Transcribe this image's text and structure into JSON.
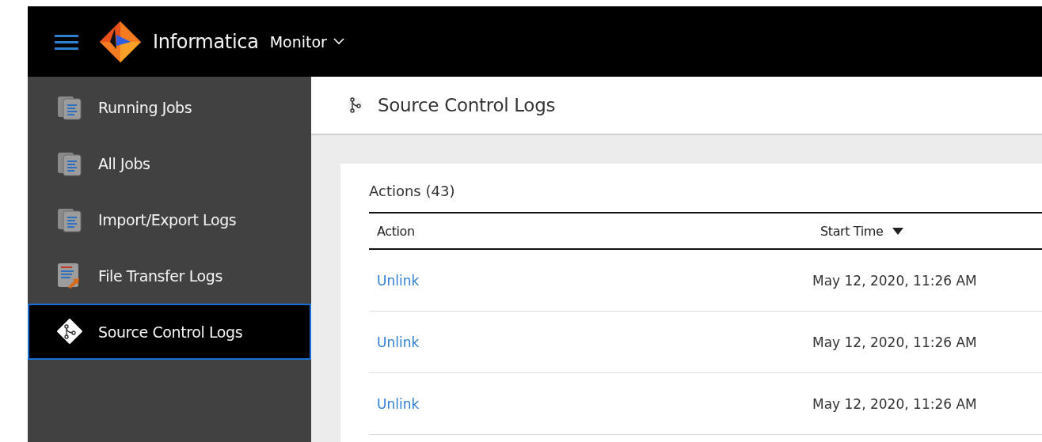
{
  "header": {
    "brand": "Informatica",
    "app_switcher": "Monitor"
  },
  "sidebar": {
    "items": [
      {
        "label": "Running Jobs",
        "kind": "jobs",
        "selected": false
      },
      {
        "label": "All Jobs",
        "kind": "jobs",
        "selected": false
      },
      {
        "label": "Import/Export Logs",
        "kind": "jobs",
        "selected": false
      },
      {
        "label": "File Transfer Logs",
        "kind": "transfer",
        "selected": false
      },
      {
        "label": "Source Control Logs",
        "kind": "source",
        "selected": true
      }
    ]
  },
  "page": {
    "title": "Source Control Logs"
  },
  "table": {
    "title": "Actions (43)",
    "columns": [
      {
        "label": "Action",
        "sorted": false
      },
      {
        "label": "Start Time",
        "sorted": true
      }
    ],
    "rows": [
      {
        "action": "Unlink",
        "start_time": "May 12, 2020, 11:26 AM"
      },
      {
        "action": "Unlink",
        "start_time": "May 12, 2020, 11:26 AM"
      },
      {
        "action": "Unlink",
        "start_time": "May 12, 2020, 11:26 AM"
      }
    ]
  }
}
